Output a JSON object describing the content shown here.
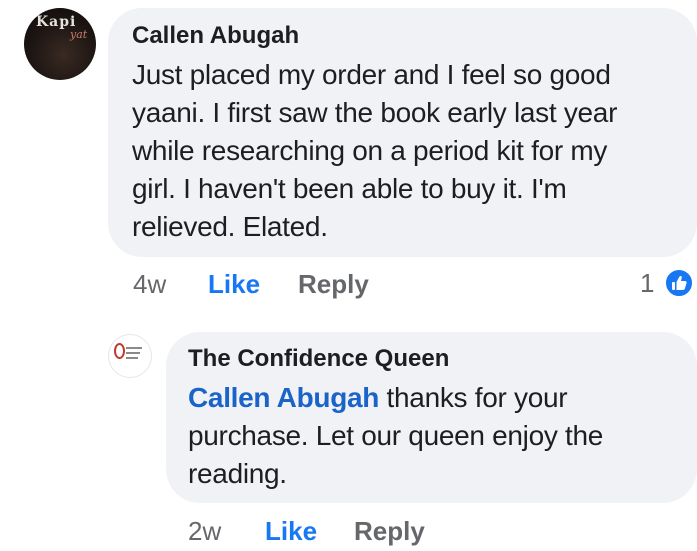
{
  "comments": [
    {
      "author": "Callen Abugah",
      "avatar_watermark": "Kapi",
      "avatar_watermark_sub": "yat",
      "text_lines": [
        "Just placed my order and I feel so good",
        "yaani. I first saw the book early last year",
        "while researching on a period kit for my",
        "girl. I haven't been able to buy it. I'm",
        "relieved. Elated."
      ],
      "time": "4w",
      "like_label": "Like",
      "reply_label": "Reply",
      "reaction_count": "1",
      "reaction_icon": "thumbs-up-icon"
    },
    {
      "author": "The Confidence Queen",
      "avatar_logo_text": "The Confidence Queen",
      "mention": "Callen Abugah",
      "text_lines": [
        " thanks for your",
        "purchase. Let our queen enjoy the",
        "reading."
      ],
      "time": "2w",
      "like_label": "Like",
      "reply_label": "Reply"
    }
  ],
  "colors": {
    "bubble": "#f0f2f5",
    "link": "#1877f2",
    "mention": "#1a63c9",
    "muted": "#65676b"
  }
}
